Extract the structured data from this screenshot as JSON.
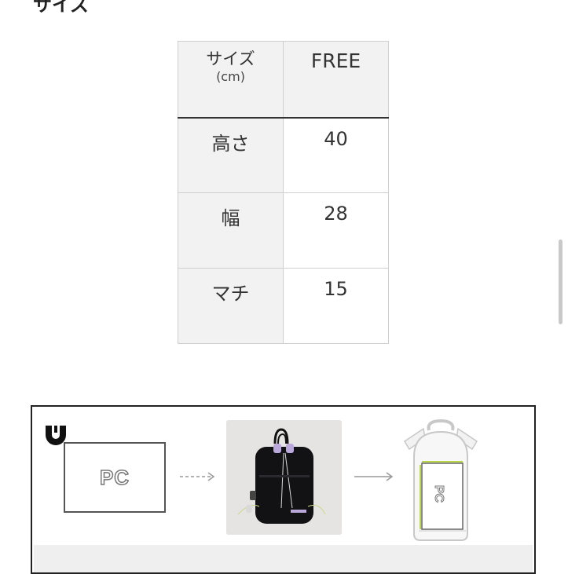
{
  "header": {
    "title": "サイズ"
  },
  "size_table": {
    "header": {
      "label_main": "サイズ",
      "label_unit": "(cm)",
      "value": "FREE"
    },
    "rows": [
      {
        "label": "高さ",
        "value": "40"
      },
      {
        "label": "幅",
        "value": "28"
      },
      {
        "label": "マチ",
        "value": "15"
      }
    ]
  },
  "guide": {
    "pc_label": "PC",
    "bag_pc_label": "PC"
  },
  "colors": {
    "accent_green": "#b8d84a",
    "border": "#cfcfcf",
    "header_fill": "#f2f2f2"
  }
}
